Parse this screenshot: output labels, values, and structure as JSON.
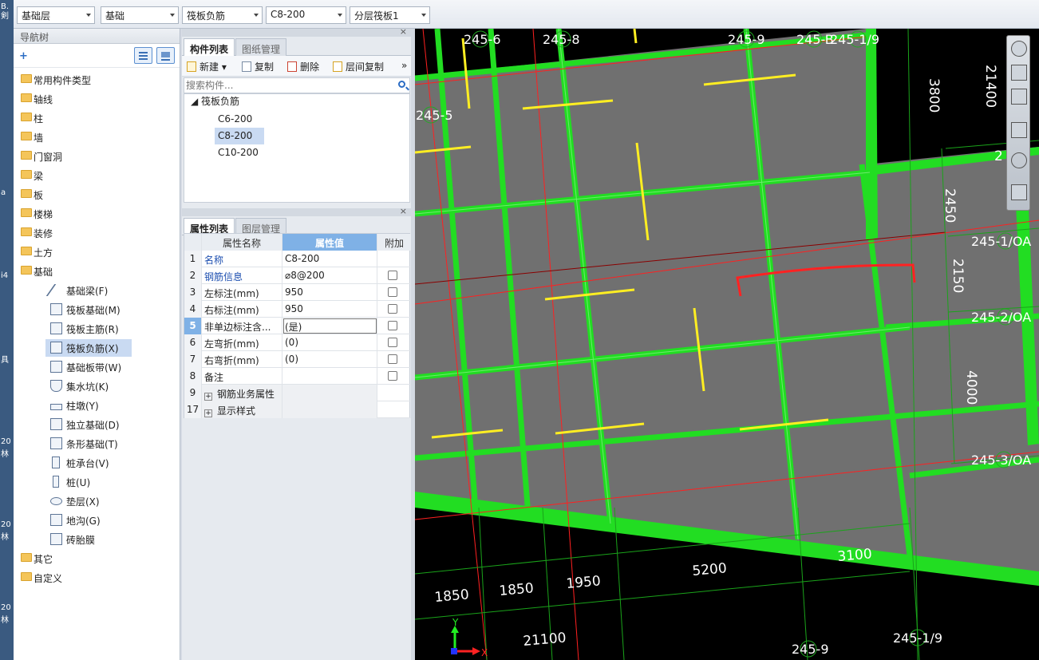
{
  "left_strip": [
    "B.",
    "剣",
    "a",
    "i4",
    "具",
    "20",
    "林",
    "20",
    "林",
    "20",
    "林"
  ],
  "topbar": {
    "combos": [
      "基础层",
      "基础",
      "筏板负筋",
      "C8-200",
      "分层筏板1"
    ]
  },
  "nav": {
    "title": "导航树",
    "add_label": "+",
    "items": [
      "常用构件类型",
      "轴线",
      "柱",
      "墙",
      "门窗洞",
      "梁",
      "板",
      "楼梯",
      "装修",
      "土方",
      "基础"
    ],
    "sub_items": [
      "基础梁(F)",
      "筏板基础(M)",
      "筏板主筋(R)",
      "筏板负筋(X)",
      "基础板带(W)",
      "集水坑(K)",
      "柱墩(Y)",
      "独立基础(D)",
      "条形基础(T)",
      "桩承台(V)",
      "桩(U)",
      "垫层(X)",
      "地沟(G)",
      "砖胎膜"
    ],
    "selected_sub": "筏板负筋(X)",
    "items_after": [
      "其它",
      "自定义"
    ]
  },
  "component_panel": {
    "tabs": [
      "构件列表",
      "图纸管理"
    ],
    "close": "×",
    "toolbar": {
      "new": "新建",
      "copy": "复制",
      "delete": "删除",
      "floor_copy": "层间复制",
      "more": "»"
    },
    "search_placeholder": "搜索构件...",
    "tree_root": "筏板负筋",
    "tree_items": [
      "C6-200",
      "C8-200",
      "C10-200"
    ],
    "selected": "C8-200"
  },
  "property_panel": {
    "tabs": [
      "属性列表",
      "图层管理"
    ],
    "close": "×",
    "headers": {
      "name": "属性名称",
      "value": "属性值",
      "add": "附加"
    },
    "rows": [
      {
        "num": "1",
        "name": "名称",
        "value": "C8-200",
        "blue": true,
        "check": false
      },
      {
        "num": "2",
        "name": "钢筋信息",
        "value": "⌀8@200",
        "blue": true,
        "check": true
      },
      {
        "num": "3",
        "name": "左标注(mm)",
        "value": "950",
        "blue": false,
        "check": true
      },
      {
        "num": "4",
        "name": "右标注(mm)",
        "value": "950",
        "blue": false,
        "check": true
      },
      {
        "num": "5",
        "name": "非单边标注含...",
        "value": "(是)",
        "blue": false,
        "check": true
      },
      {
        "num": "6",
        "name": "左弯折(mm)",
        "value": "(0)",
        "blue": false,
        "check": true
      },
      {
        "num": "7",
        "name": "右弯折(mm)",
        "value": "(0)",
        "blue": false,
        "check": true
      },
      {
        "num": "8",
        "name": "备注",
        "value": "",
        "blue": false,
        "check": true
      },
      {
        "num": "9",
        "name": "钢筋业务属性",
        "value": "",
        "blue": false,
        "check": false,
        "expand": "+"
      },
      {
        "num": "17",
        "name": "显示样式",
        "value": "",
        "blue": false,
        "check": false,
        "expand": "+"
      }
    ]
  },
  "canvas": {
    "axis_labels_top": [
      "245-6",
      "245-8",
      "245-9",
      "245-B",
      "245-1/9"
    ],
    "axis_labels_left": [
      "245-5"
    ],
    "axis_labels_right": [
      "245-1/OA",
      "245-2/OA",
      "245-3/OA"
    ],
    "axis_labels_bottom": [
      "245-9",
      "245-1/9"
    ],
    "dims_right": [
      "21400",
      "3800",
      "2450",
      "2150",
      "4000"
    ],
    "dims_bottom": [
      "1850",
      "1850",
      "1950",
      "5200",
      "3100",
      "21100"
    ],
    "right_clip": "2",
    "coord_y": "Y",
    "coord_x": "X"
  }
}
